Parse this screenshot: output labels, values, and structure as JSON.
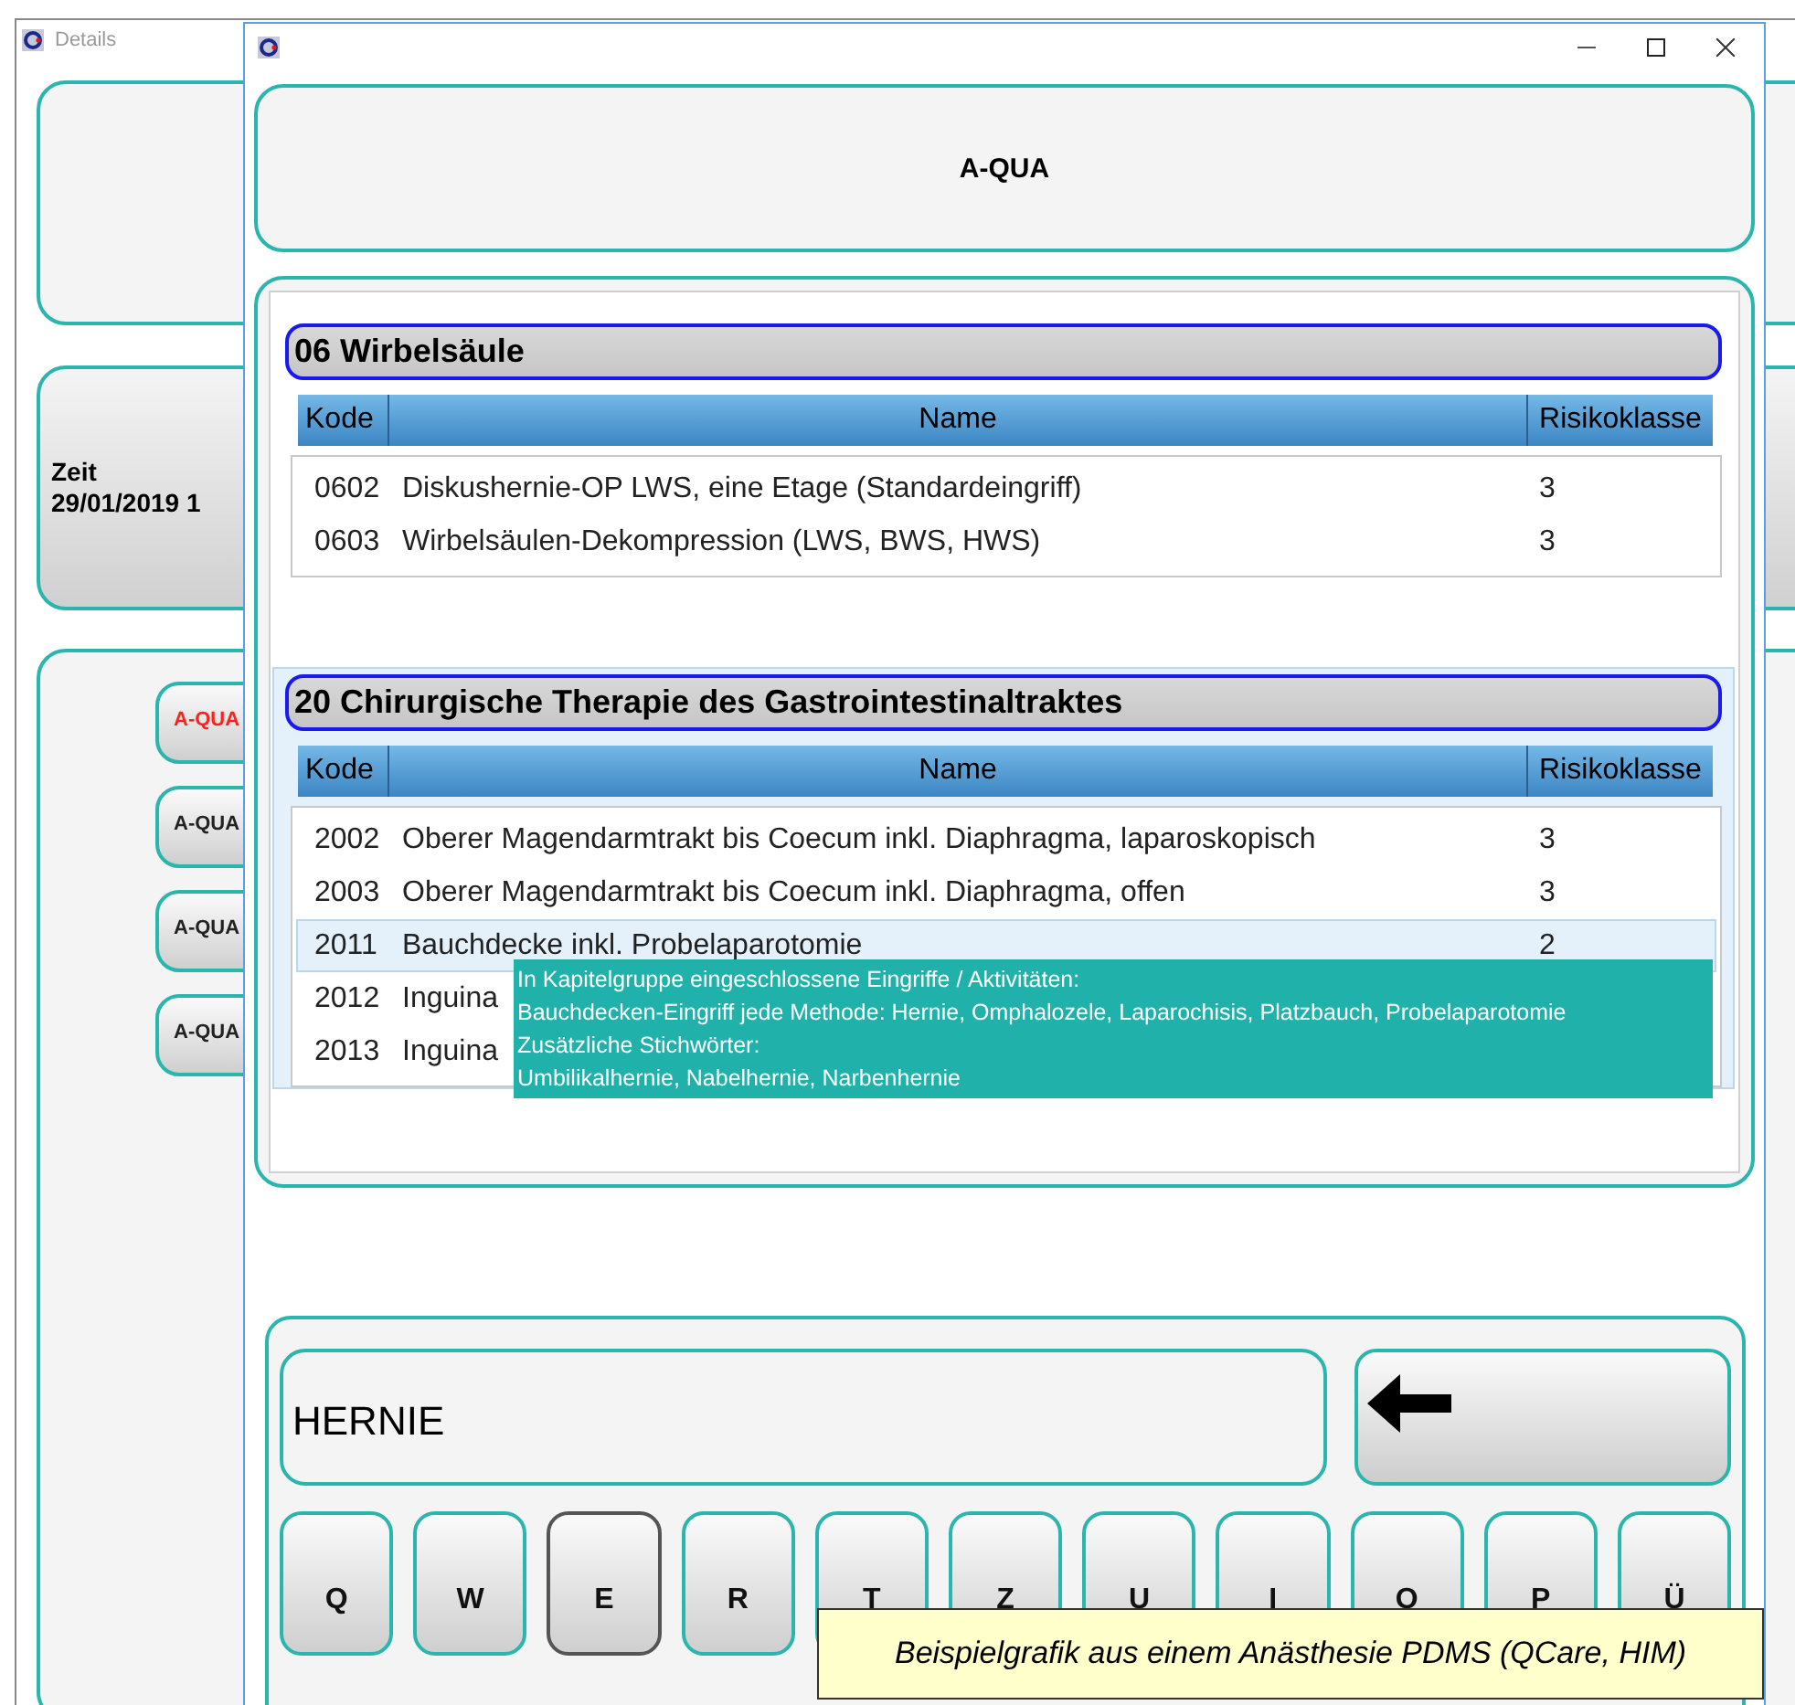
{
  "background_window": {
    "title": "Details",
    "time_label": "Zeit",
    "time_value": "29/01/2019 1",
    "buttons": [
      {
        "label": "A-QUA",
        "alert": true
      },
      {
        "label": "A-QUA",
        "alert": false
      },
      {
        "label": "A-QUA",
        "alert": false
      },
      {
        "label": "A-QUA",
        "alert": false
      }
    ]
  },
  "dialog": {
    "header": "A-QUA",
    "groups": [
      {
        "title": "06 Wirbelsäule",
        "highlighted": false,
        "columns": [
          "Kode",
          "Name",
          "Risikoklasse"
        ],
        "rows": [
          {
            "code": "0602",
            "name": "Diskushernie-OP LWS, eine Etage (Standardeingriff)",
            "risk": "3",
            "selected": false
          },
          {
            "code": "0603",
            "name": "Wirbelsäulen-Dekompression (LWS, BWS, HWS)",
            "risk": "3",
            "selected": false
          }
        ]
      },
      {
        "title": "20 Chirurgische Therapie des Gastrointestinaltraktes",
        "highlighted": true,
        "columns": [
          "Kode",
          "Name",
          "Risikoklasse"
        ],
        "rows": [
          {
            "code": "2002",
            "name": "Oberer Magendarmtrakt bis Coecum inkl. Diaphragma, laparoskopisch",
            "risk": "3",
            "selected": false
          },
          {
            "code": "2003",
            "name": "Oberer Magendarmtrakt bis Coecum inkl. Diaphragma, offen",
            "risk": "3",
            "selected": false
          },
          {
            "code": "2011",
            "name": "Bauchdecke inkl. Probelaparotomie",
            "risk": "2",
            "selected": true
          },
          {
            "code": "2012",
            "name": "Inguina",
            "risk": "",
            "selected": false
          },
          {
            "code": "2013",
            "name": "Inguina",
            "risk": "",
            "selected": false
          }
        ]
      }
    ],
    "tooltip": [
      "In Kapitelgruppe eingeschlossene Eingriffe / Aktivitäten:",
      "Bauchdecken-Eingriff jede Methode: Hernie, Omphalozele, Laparochisis, Platzbauch, Probelaparotomie",
      "Zusätzliche Stichwörter:",
      "Umbilikalhernie, Nabelhernie, Narbenhernie"
    ],
    "search_value": "HERNIE",
    "keys": [
      {
        "label": "Q",
        "selected": false
      },
      {
        "label": "W",
        "selected": false
      },
      {
        "label": "E",
        "selected": true
      },
      {
        "label": "R",
        "selected": false
      },
      {
        "label": "T",
        "selected": false
      },
      {
        "label": "Z",
        "selected": false
      },
      {
        "label": "U",
        "selected": false
      },
      {
        "label": "I",
        "selected": false
      },
      {
        "label": "O",
        "selected": false
      },
      {
        "label": "P",
        "selected": false
      },
      {
        "label": "Ü",
        "selected": false
      }
    ]
  },
  "caption": "Beispielgrafik aus einem Anästhesie PDMS (QCare, HIM)"
}
